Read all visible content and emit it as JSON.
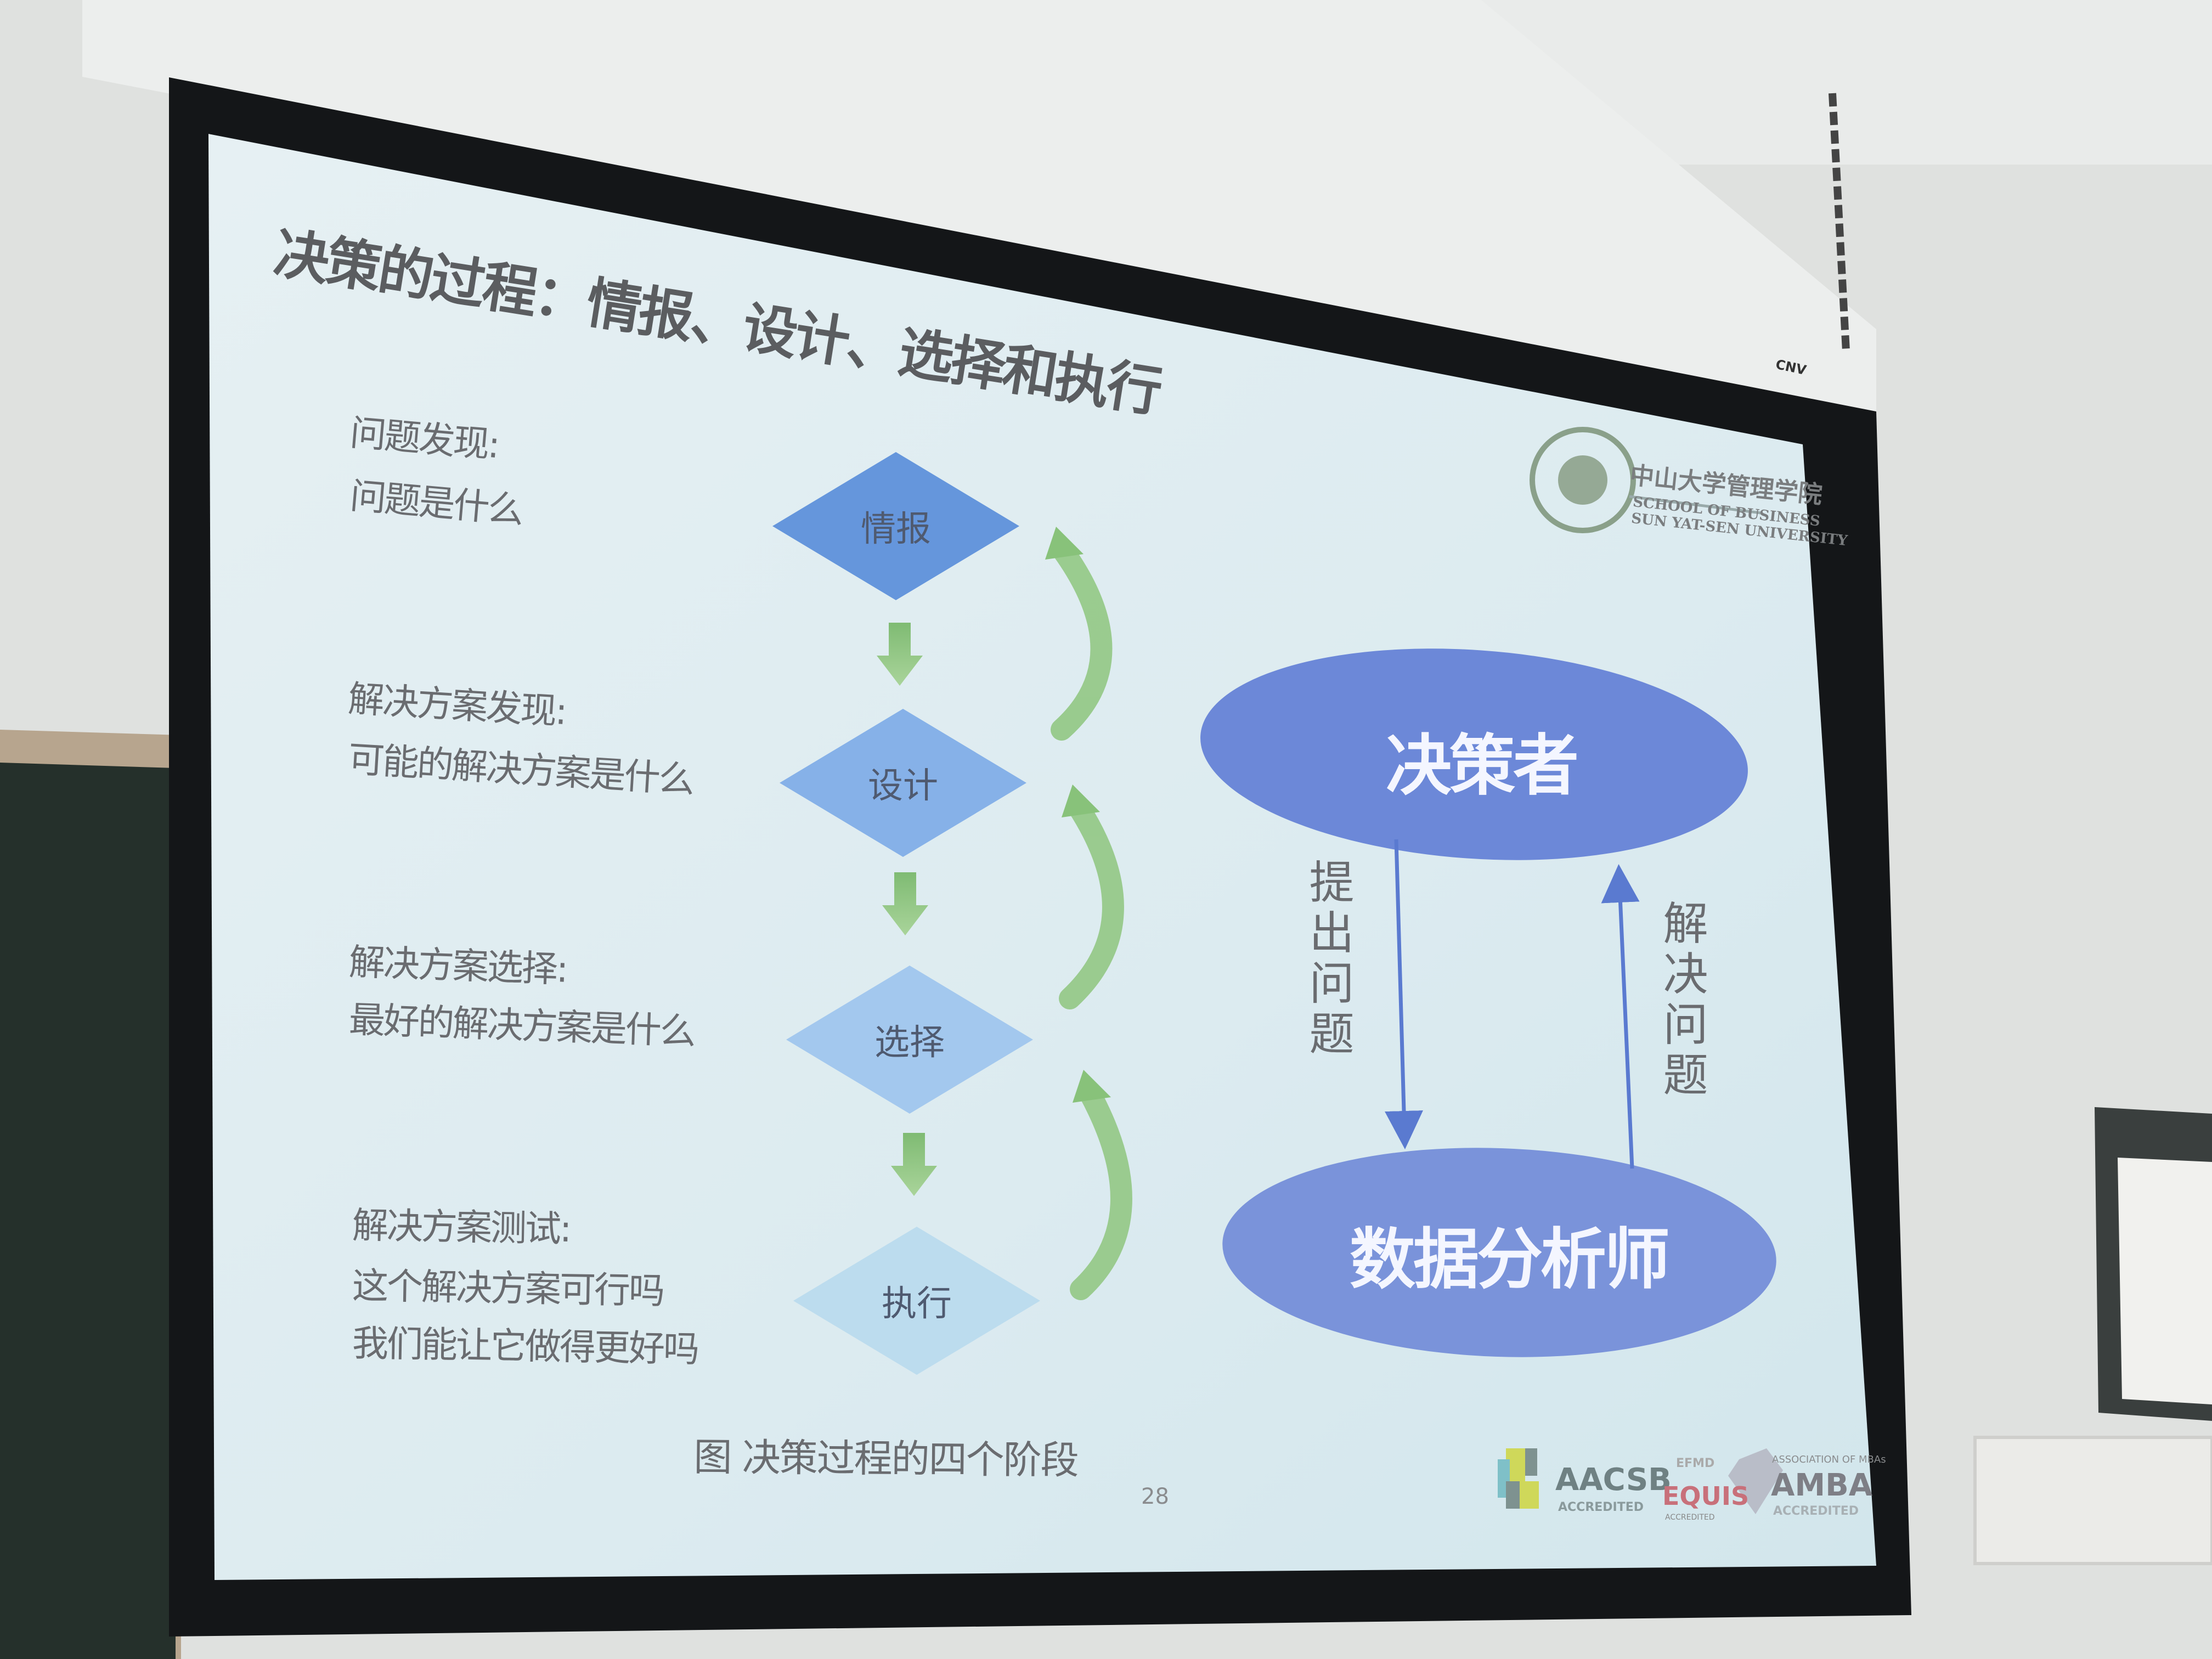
{
  "slide": {
    "title": "决策的过程：情报、设计、选择和执行",
    "stages": [
      {
        "heading": "问题发现:",
        "lines": [
          "问题是什么"
        ],
        "diamond": "情报",
        "color": "#6596dc"
      },
      {
        "heading": "解决方案发现:",
        "lines": [
          "可能的解决方案是什么"
        ],
        "diamond": "设计",
        "color": "#86b1e8"
      },
      {
        "heading": "解决方案选择:",
        "lines": [
          "最好的解决方案是什么"
        ],
        "diamond": "选择",
        "color": "#a3c8ee"
      },
      {
        "heading": "解决方案测试:",
        "lines": [
          "这个解决方案可行吗",
          "我们能让它做得更好吗"
        ],
        "diamond": "执行",
        "color": "#bcdcee"
      }
    ],
    "decision_maker": "决策者",
    "analyst": "数据分析师",
    "ask_label": "提出问题",
    "solve_label": "解决问题",
    "caption": "图  决策过程的四个阶段",
    "page_number": "28",
    "logo": {
      "seal_text": "中山大學 SUN YAT-SEN UNIVERSITY",
      "cn": "中山大学管理学院",
      "en1": "SCHOOL OF BUSINESS",
      "en2": "SUN YAT-SEN UNIVERSITY"
    },
    "accreditations": {
      "aacsb": "AACSB",
      "aacsb_sub": "ACCREDITED",
      "efmd": "EFMD",
      "equis": "EQUIS",
      "equis_sub": "ACCREDITED",
      "amba_top": "ASSOCIATION OF MBAs",
      "amba": "AMBA",
      "amba_sub": "ACCREDITED"
    },
    "colors": {
      "ellipse": "#6c88d8",
      "arrow_green": "#8cc47e",
      "arrow_blue": "#5a7ad0"
    }
  },
  "room": {
    "screen_brand": "CNV"
  }
}
